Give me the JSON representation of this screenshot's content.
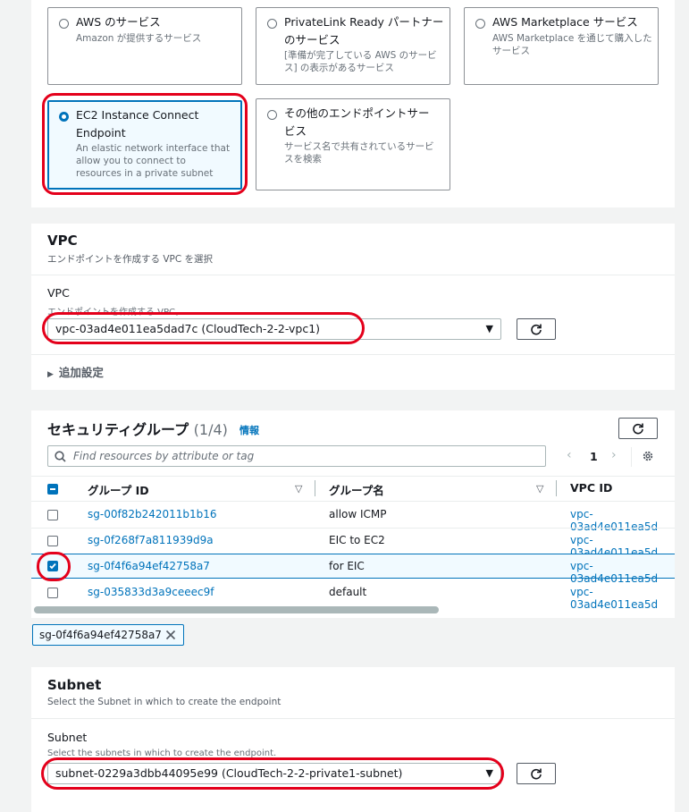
{
  "endpoint_types": [
    {
      "title": "AWS のサービス",
      "desc": "Amazon が提供するサービス",
      "selected": false
    },
    {
      "title": "PrivateLink Ready パートナーのサービス",
      "desc": "[準備が完了している AWS のサービス] の表示があるサービス",
      "selected": false
    },
    {
      "title": "AWS Marketplace サービス",
      "desc": "AWS Marketplace を通じて購入したサービス",
      "selected": false
    },
    {
      "title": "EC2 Instance Connect Endpoint",
      "desc": "An elastic network interface that allow you to connect to resources in a private subnet",
      "selected": true
    },
    {
      "title": "その他のエンドポイントサービス",
      "desc": "サービス名で共有されているサービスを検索",
      "selected": false
    }
  ],
  "vpc": {
    "heading": "VPC",
    "subheading": "エンドポイントを作成する VPC を選択",
    "field_label": "VPC",
    "field_hint": "エンドポイントを作成する VPC。",
    "selected_value": "vpc-03ad4e011ea5dad7c (CloudTech-2-2-vpc1)",
    "additional_settings": "追加設定"
  },
  "security_groups": {
    "heading": "セキュリティグループ",
    "count": "(1/4)",
    "info": "情報",
    "search_placeholder": "Find resources by attribute or tag",
    "page": "1",
    "columns": [
      "グループ ID",
      "グループ名",
      "VPC ID"
    ],
    "rows": [
      {
        "id": "sg-00f82b242011b1b16",
        "name": "allow ICMP",
        "vpc": "vpc-03ad4e011ea5d",
        "checked": false
      },
      {
        "id": "sg-0f268f7a811939d9a",
        "name": "EIC to EC2",
        "vpc": "vpc-03ad4e011ea5d",
        "checked": false
      },
      {
        "id": "sg-0f4f6a94ef42758a7",
        "name": "for EIC",
        "vpc": "vpc-03ad4e011ea5d",
        "checked": true
      },
      {
        "id": "sg-035833d3a9ceeec9f",
        "name": "default",
        "vpc": "vpc-03ad4e011ea5d",
        "checked": false
      }
    ],
    "selected_token": "sg-0f4f6a94ef42758a7"
  },
  "subnet": {
    "heading": "Subnet",
    "subheading": "Select the Subnet in which to create the endpoint",
    "field_label": "Subnet",
    "field_hint": "Select the subnets in which to create the endpoint.",
    "selected_value": "subnet-0229a3dbb44095e99 (CloudTech-2-2-private1-subnet)"
  },
  "colors": {
    "accent": "#0073bb",
    "annotation": "#e4001b"
  },
  "icons": {
    "refresh": "refresh-icon",
    "search": "search-icon",
    "settings": "gear-icon",
    "close": "close-icon"
  }
}
